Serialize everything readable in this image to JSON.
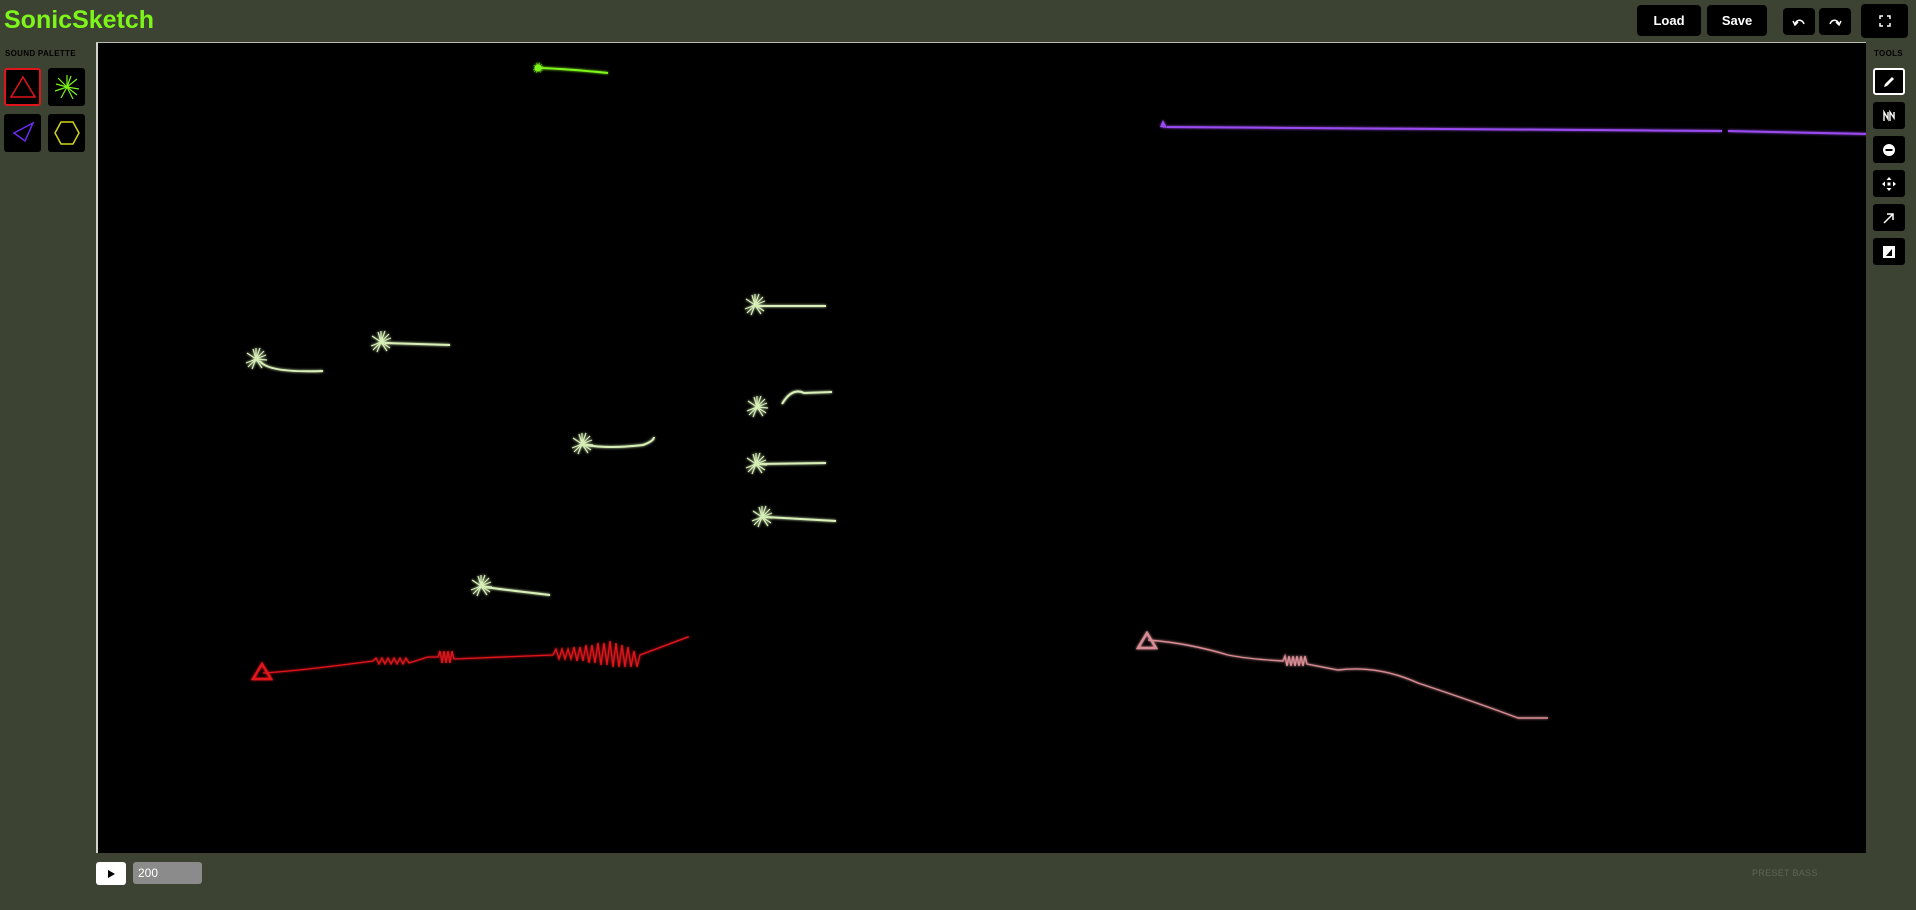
{
  "app": {
    "title": "SonicSketch"
  },
  "toolbar": {
    "load_label": "Load",
    "save_label": "Save",
    "undo_icon": "undo-icon",
    "redo_icon": "redo-icon",
    "fullscreen_icon": "fullscreen-icon"
  },
  "palette": {
    "label": "SOUND PALETTE",
    "items": [
      {
        "name": "triangle",
        "icon": "triangle-icon",
        "color": "#e0141b",
        "selected": true
      },
      {
        "name": "burst",
        "icon": "burst-icon",
        "color": "#7ef51a",
        "selected": false
      },
      {
        "name": "arrow",
        "icon": "arrow-icon",
        "color": "#6a2cf0",
        "selected": false
      },
      {
        "name": "hexagon",
        "icon": "hexagon-icon",
        "color": "#d4d41a",
        "selected": false
      }
    ]
  },
  "tools": {
    "label": "TOOLS",
    "items": [
      {
        "icon": "pencil-icon",
        "selected": true
      },
      {
        "icon": "wave-icon",
        "selected": false
      },
      {
        "icon": "eraser-icon",
        "selected": false
      },
      {
        "icon": "move-icon",
        "selected": false
      },
      {
        "icon": "arrow-up-right-icon",
        "selected": false
      },
      {
        "icon": "color-icon",
        "selected": false
      }
    ]
  },
  "transport": {
    "tempo": "200",
    "preset_label": "PRESET BASS"
  },
  "colors": {
    "background": "#3d4333",
    "accent": "#7ef51a",
    "red": "#e0141b",
    "purple": "#9a4cf0",
    "pink": "#d88c93",
    "pale_green": "#d8f0b8"
  }
}
